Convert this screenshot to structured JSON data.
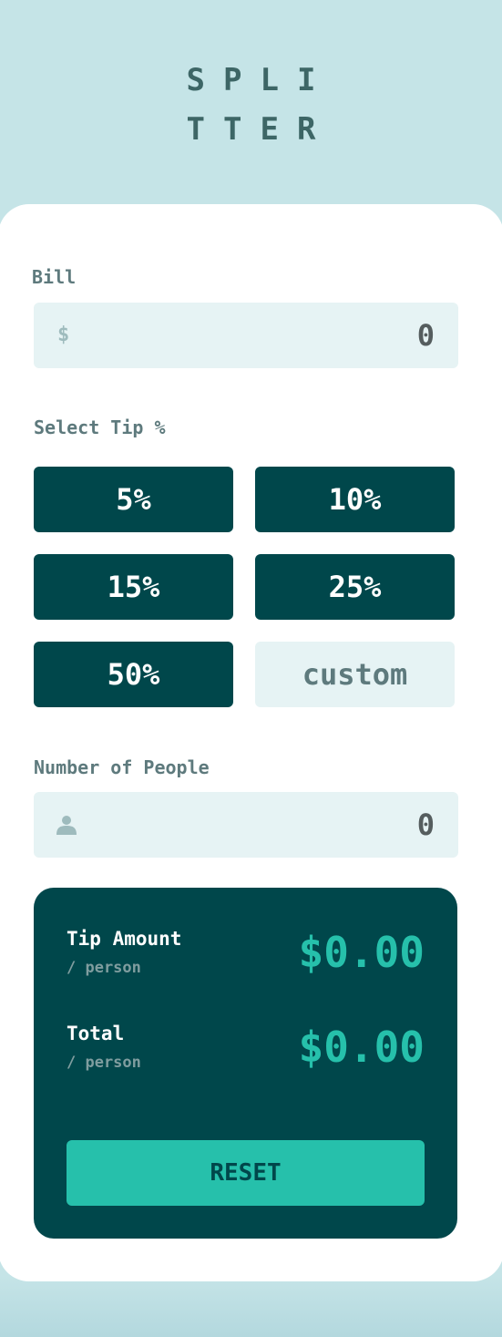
{
  "logo": {
    "line1": "SPLI",
    "line2": "TTER"
  },
  "bill": {
    "label": "Bill",
    "prefix": "$",
    "value": "0"
  },
  "tip": {
    "label": "Select Tip %",
    "options": [
      "5%",
      "10%",
      "15%",
      "25%",
      "50%"
    ],
    "custom_placeholder": "custom"
  },
  "people": {
    "label": "Number of People",
    "icon": "person-icon",
    "value": "0"
  },
  "results": {
    "tip_amount_label": "Tip Amount",
    "tip_amount_sub": "/ person",
    "tip_amount_value": "$0.00",
    "total_label": "Total",
    "total_sub": "/ person",
    "total_value": "$0.00",
    "reset_label": "RESET"
  },
  "colors": {
    "background": "#c5e4e7",
    "dark_cyan": "#00474b",
    "strong_cyan": "#26c0ab",
    "light_field": "#e6f3f4"
  }
}
